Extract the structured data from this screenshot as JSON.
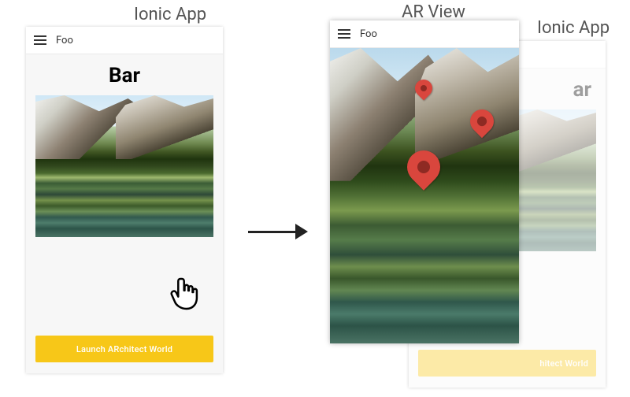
{
  "labels": {
    "ionic_left": "Ionic App",
    "ar_view": "AR View",
    "ionic_right": "Ionic App"
  },
  "left_phone": {
    "header_title": "Foo",
    "page_title": "Bar",
    "button_label": "Launch ARchitect World"
  },
  "right_bg_phone": {
    "header_title": "Foo",
    "page_title_visible": "ar",
    "button_label_visible": "hitect World"
  },
  "ar_phone": {
    "header_title": "Foo"
  },
  "colors": {
    "button_bg": "#f7c718"
  }
}
